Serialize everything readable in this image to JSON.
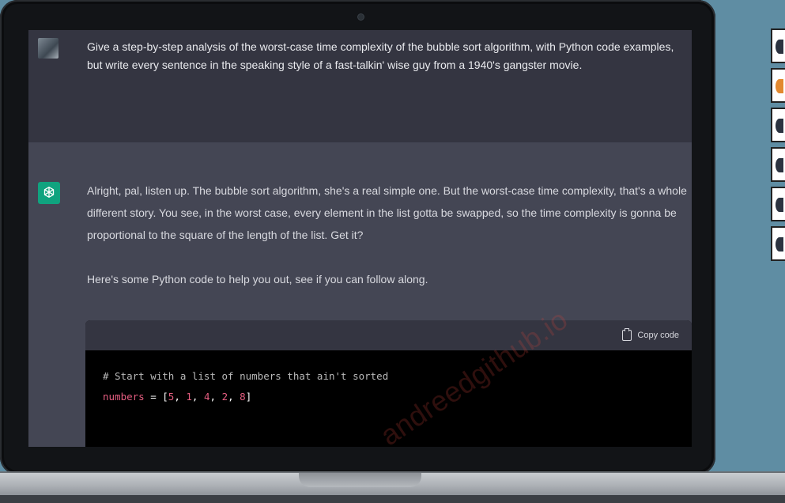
{
  "conversation": {
    "user_prompt": "Give a step-by-step analysis of the worst-case time complexity of the bubble sort algorithm, with Python code examples, but write every sentence in the speaking style of a fast-talkin' wise guy from a 1940's gangster movie.",
    "assistant_paragraph_1": "Alright, pal, listen up. The bubble sort algorithm, she's a real simple one. But the worst-case time complexity, that's a whole different story. You see, in the worst case, every element in the list gotta be swapped, so the time complexity is gonna be proportional to the square of the length of the list. Get it?",
    "assistant_paragraph_2": "Here's some Python code to help you out, see if you can follow along.",
    "code": {
      "copy_label": "Copy code",
      "comment_line": "# Start with a list of numbers that ain't sorted",
      "var_name": "numbers",
      "assign": " = [",
      "numbers": [
        "5",
        "1",
        "4",
        "2",
        "8"
      ],
      "close": "]"
    }
  },
  "watermark": "andreedgithub.io",
  "icons": {
    "user_avatar": "user-avatar-photo",
    "assistant_avatar": "openai-logo-icon",
    "copy": "clipboard-icon"
  },
  "colors": {
    "background": "#5f8da3",
    "user_bg": "#343541",
    "assistant_bg": "#444654",
    "accent": "#10a37f",
    "code_token": "#e55d80"
  },
  "side_boxes": [
    {
      "mark_color": "#2b3340"
    },
    {
      "mark_color": "#e2892f"
    },
    {
      "mark_color": "#2b3340"
    },
    {
      "mark_color": "#2b3340"
    },
    {
      "mark_color": "#2b3340"
    },
    {
      "mark_color": "#2b3340"
    }
  ]
}
